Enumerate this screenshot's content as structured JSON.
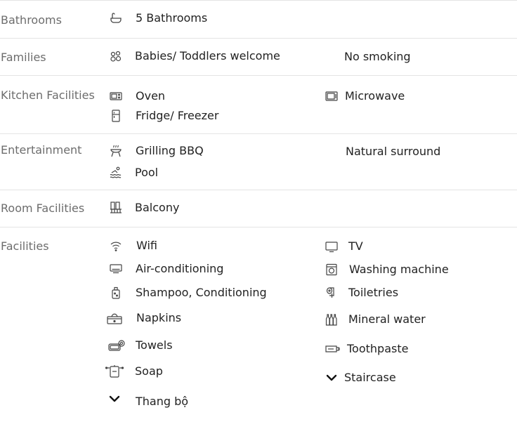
{
  "sections": {
    "bathrooms": {
      "label": "Bathrooms",
      "items": [
        "5 Bathrooms"
      ]
    },
    "families": {
      "label": "Families",
      "items": [
        "Babies/ Toddlers welcome",
        "No smoking"
      ]
    },
    "kitchen": {
      "label": "Kitchen Facilities",
      "items": [
        "Oven",
        "Microwave",
        "Fridge/ Freezer"
      ]
    },
    "entertainment": {
      "label": "Entertainment",
      "items": [
        "Grilling BBQ",
        "Natural surround",
        "Pool"
      ]
    },
    "room": {
      "label": "Room Facilities",
      "items": [
        "Balcony"
      ]
    },
    "facilities": {
      "label": "Facilities",
      "items": [
        "Wifi",
        "TV",
        "Air-conditioning",
        "Washing machine",
        "Shampoo, Conditioning",
        "Toiletries",
        "Napkins",
        "Mineral water",
        "Towels",
        "Toothpaste",
        "Soap",
        "Staircase",
        "Thang bộ"
      ]
    }
  }
}
